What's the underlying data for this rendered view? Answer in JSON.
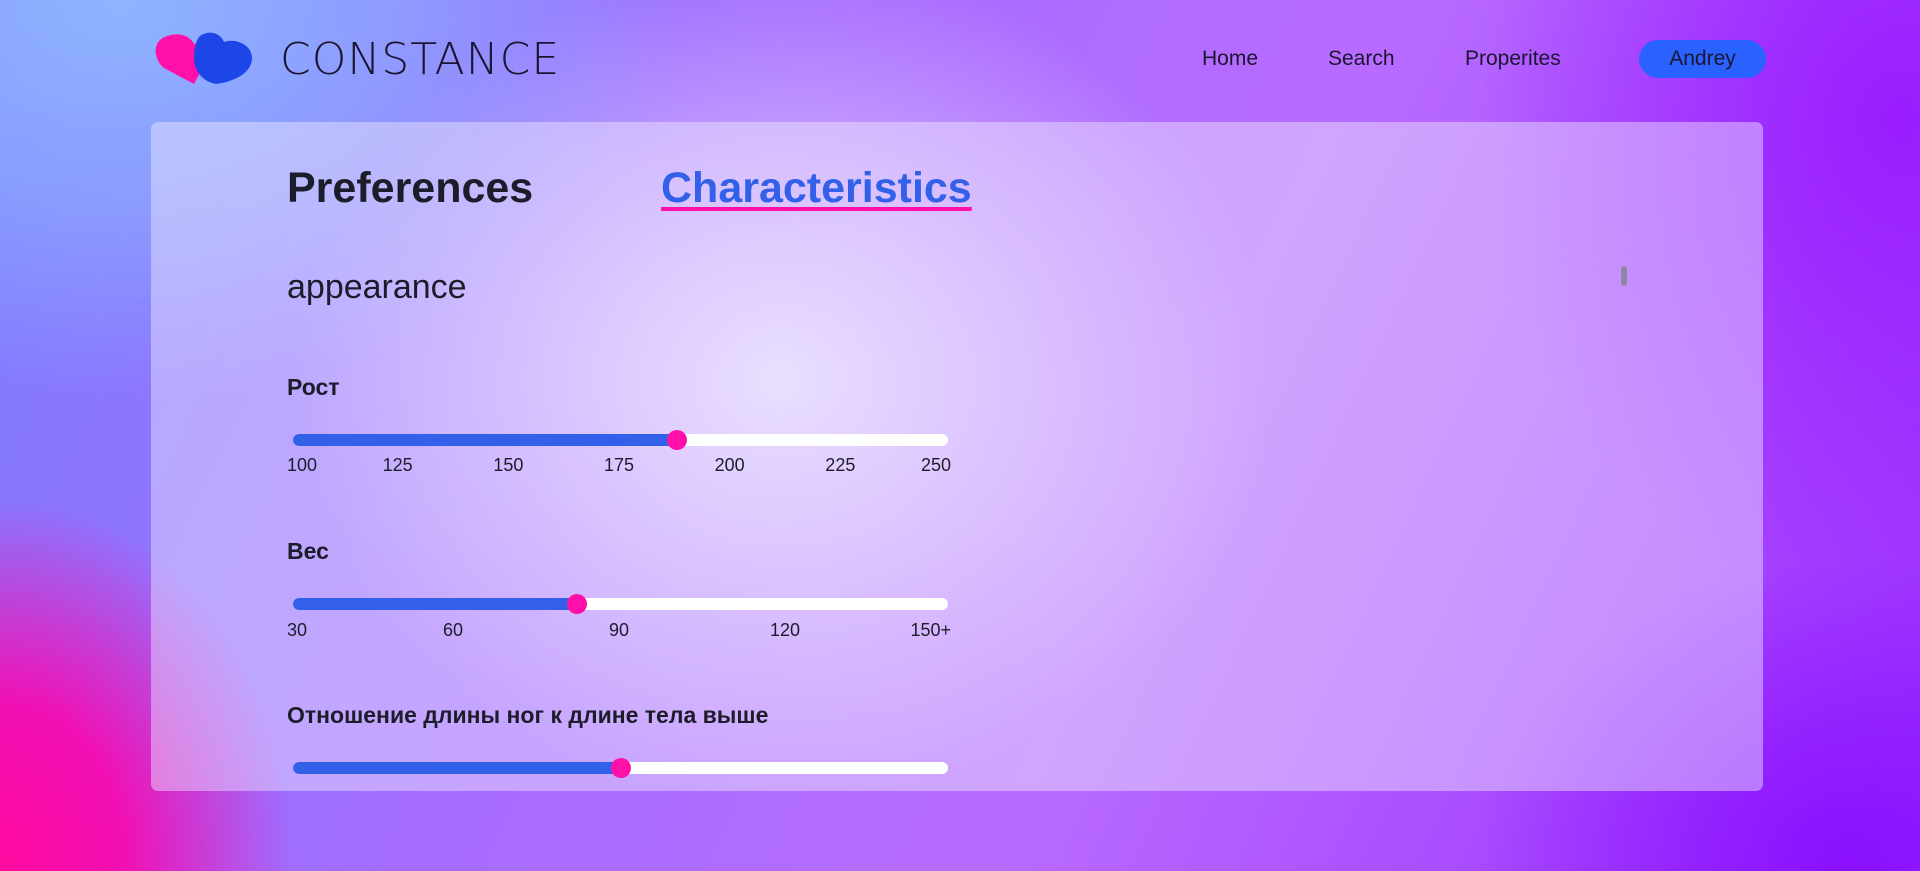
{
  "header": {
    "brand": "CONSTANCE",
    "logo_icon": "two-hearts-logo",
    "nav": [
      "Home",
      "Search",
      "Properites"
    ],
    "user": "Andrey"
  },
  "colors": {
    "accent_blue": "#3360e8",
    "accent_pink": "#ff10a8",
    "user_button": "#2a62ff"
  },
  "tabs": {
    "preferences": "Preferences",
    "characteristics": "Characteristics",
    "active": "Characteristics"
  },
  "section": {
    "title": "appearance"
  },
  "sliders": [
    {
      "label": "Рост",
      "ticks": [
        "100",
        "125",
        "150",
        "175",
        "200",
        "225",
        "250"
      ],
      "min": 100,
      "max": 250,
      "value": 188
    },
    {
      "label": "Вес",
      "ticks": [
        "30",
        "60",
        "90",
        "120",
        "150+"
      ],
      "min": 30,
      "max": 150,
      "value": 82
    },
    {
      "label": "Отношение длины ног к длине тела выше",
      "value_fraction": 0.5
    }
  ]
}
